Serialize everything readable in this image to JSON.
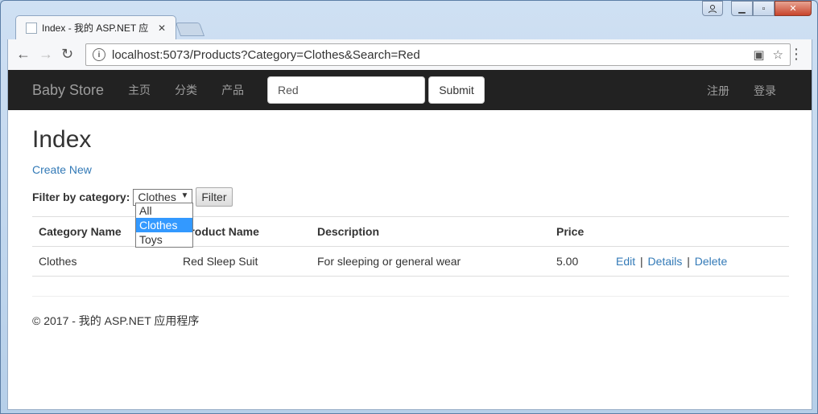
{
  "browser": {
    "tab_title": "Index - 我的 ASP.NET 应",
    "url": "localhost:5073/Products?Category=Clothes&Search=Red"
  },
  "navbar": {
    "brand": "Baby Store",
    "links": [
      "主页",
      "分类",
      "产品"
    ],
    "search_value": "Red",
    "submit_label": "Submit",
    "register": "注册",
    "login": "登录"
  },
  "page": {
    "title": "Index",
    "create_new": "Create New",
    "filter_label": "Filter by category:",
    "filter_selected": "Clothes",
    "filter_button": "Filter",
    "dropdown_options": [
      "All",
      "Clothes",
      "Toys"
    ]
  },
  "table": {
    "headers": [
      "Category Name",
      "Product Name",
      "Description",
      "Price"
    ],
    "rows": [
      {
        "category": "Clothes",
        "product": "Red Sleep Suit",
        "description": "For sleeping or general wear",
        "price": "5.00"
      }
    ],
    "actions": {
      "edit": "Edit",
      "details": "Details",
      "delete": "Delete",
      "sep": "|"
    }
  },
  "footer": {
    "text": "© 2017 - 我的 ASP.NET 应用程序"
  }
}
